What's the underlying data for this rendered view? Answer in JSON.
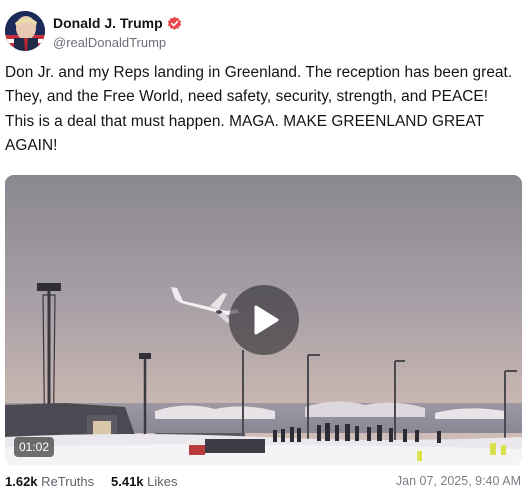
{
  "author": {
    "display_name": "Donald J. Trump",
    "handle": "@realDonaldTrump",
    "avatar_icon": "avatar-portrait",
    "verified_icon": "verified-badge-icon",
    "verified_color": "#e8474c"
  },
  "post": {
    "text": "Don Jr. and my Reps landing in Greenland. The reception has been great. They, and the Free World, need safety, security, strength, and PEACE! This is a deal that must happen. MAGA. MAKE GREENLAND GREAT AGAIN!"
  },
  "video": {
    "duration": "01:02",
    "play_icon": "play-icon"
  },
  "stats": {
    "retruths_value": "1.62k",
    "retruths_label": "ReTruths",
    "likes_value": "5.41k",
    "likes_label": "Likes"
  },
  "timestamp": "Jan 07, 2025, 9:40 AM"
}
